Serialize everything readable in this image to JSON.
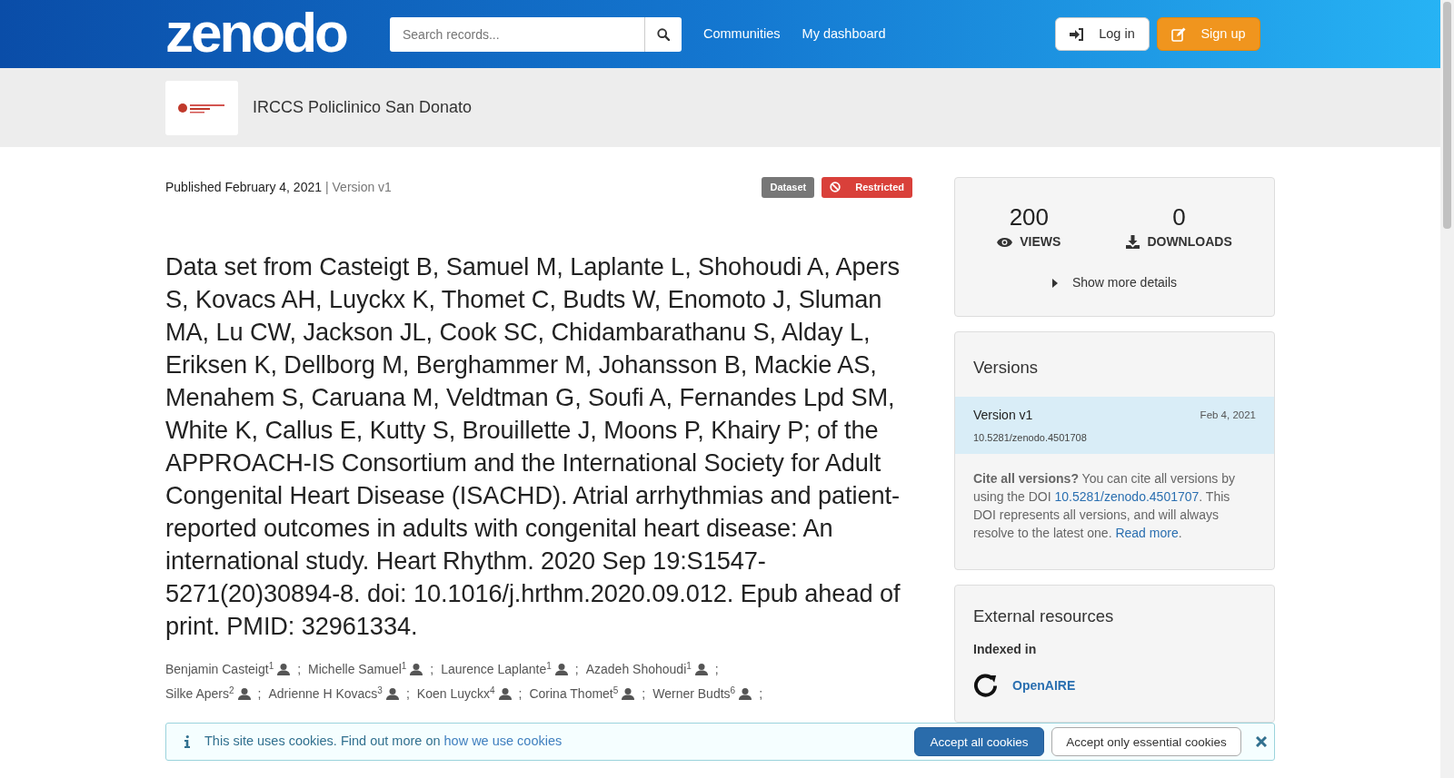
{
  "header": {
    "logo": "zenodo",
    "search": {
      "placeholder": "Search records..."
    },
    "nav": [
      {
        "label": "Communities"
      },
      {
        "label": "My dashboard"
      }
    ],
    "login": "Log in",
    "signup": "Sign up"
  },
  "community": {
    "name": "IRCCS Policlinico San Donato"
  },
  "record": {
    "published": "Published February 4, 2021",
    "version": "| Version v1",
    "badges": [
      {
        "kind": "type",
        "label": "Dataset"
      },
      {
        "kind": "access",
        "label": "Restricted"
      }
    ],
    "title": "Data set from Casteigt B, Samuel M, Laplante L, Shohoudi A, Apers S, Kovacs AH, Luyckx K, Thomet C, Budts W, Enomoto J, Sluman MA, Lu CW, Jackson JL, Cook SC, Chidambarathanu S, Alday L, Eriksen K, Dellborg M, Berghammer M, Johansson B, Mackie AS, Menahem S, Caruana M, Veldtman G, Soufi A, Fernandes Lpd SM, White K, Callus E, Kutty S, Brouillette J, Moons P, Khairy P; of the APPROACH-IS Consortium and the International Society for Adult Congenital Heart Disease (ISACHD). Atrial arrhythmias and patient-reported outcomes in adults with congenital heart disease: An international study. Heart Rhythm. 2020 Sep 19:S1547-5271(20)30894-8. doi: 10.1016/j.hrthm.2020.09.012. Epub ahead of print. PMID: 32961334.",
    "author_rows": [
      [
        {
          "name": "Benjamin Casteigt",
          "aff": "1",
          "sep": ";"
        },
        {
          "name": "Michelle Samuel",
          "aff": "1",
          "sep": ";"
        },
        {
          "name": "Laurence Laplante",
          "aff": "1",
          "sep": ";"
        },
        {
          "name": "Azadeh Shohoudi",
          "aff": "1",
          "sep": ";"
        }
      ],
      [
        {
          "name": "Silke Apers",
          "aff": "2",
          "sep": ";"
        },
        {
          "name": "Adrienne H Kovacs",
          "aff": "3",
          "sep": ";"
        },
        {
          "name": "Koen Luyckx",
          "aff": "4",
          "sep": ";"
        },
        {
          "name": "Corina Thomet",
          "aff": "5",
          "sep": ";"
        },
        {
          "name": "Werner Budts",
          "aff": "6",
          "sep": ";"
        }
      ]
    ]
  },
  "stats": {
    "items": [
      {
        "kind": "views",
        "value": "200",
        "label": "VIEWS"
      },
      {
        "kind": "downloads",
        "value": "0",
        "label": "DOWNLOADS"
      }
    ],
    "show_more": {
      "label": "Show more details",
      "expanded": false
    }
  },
  "versions": {
    "title": "Versions",
    "items": [
      {
        "label": "Version v1",
        "date": "Feb 4, 2021",
        "doi": "10.5281/zenodo.4501708",
        "selected": true
      }
    ],
    "cite": [
      {
        "kind": "bold",
        "text": "Cite all versions?"
      },
      {
        "kind": "text",
        "text": " You can cite all versions by using the DOI "
      },
      {
        "kind": "link",
        "text": "10.5281/zenodo.4501707"
      },
      {
        "kind": "text",
        "text": ". This DOI represents all versions, and will always resolve to the latest one. "
      },
      {
        "kind": "link",
        "text": "Read more"
      },
      {
        "kind": "text",
        "text": "."
      }
    ]
  },
  "external": {
    "title": "External resources",
    "subtitle": "Indexed in",
    "items": [
      {
        "name": "OpenAIRE"
      }
    ]
  },
  "cookie": {
    "text": "This site uses cookies. Find out more on",
    "link": "how we use cookies",
    "accept_all": "Accept all cookies",
    "accept_essential": "Accept only essential cookies"
  }
}
